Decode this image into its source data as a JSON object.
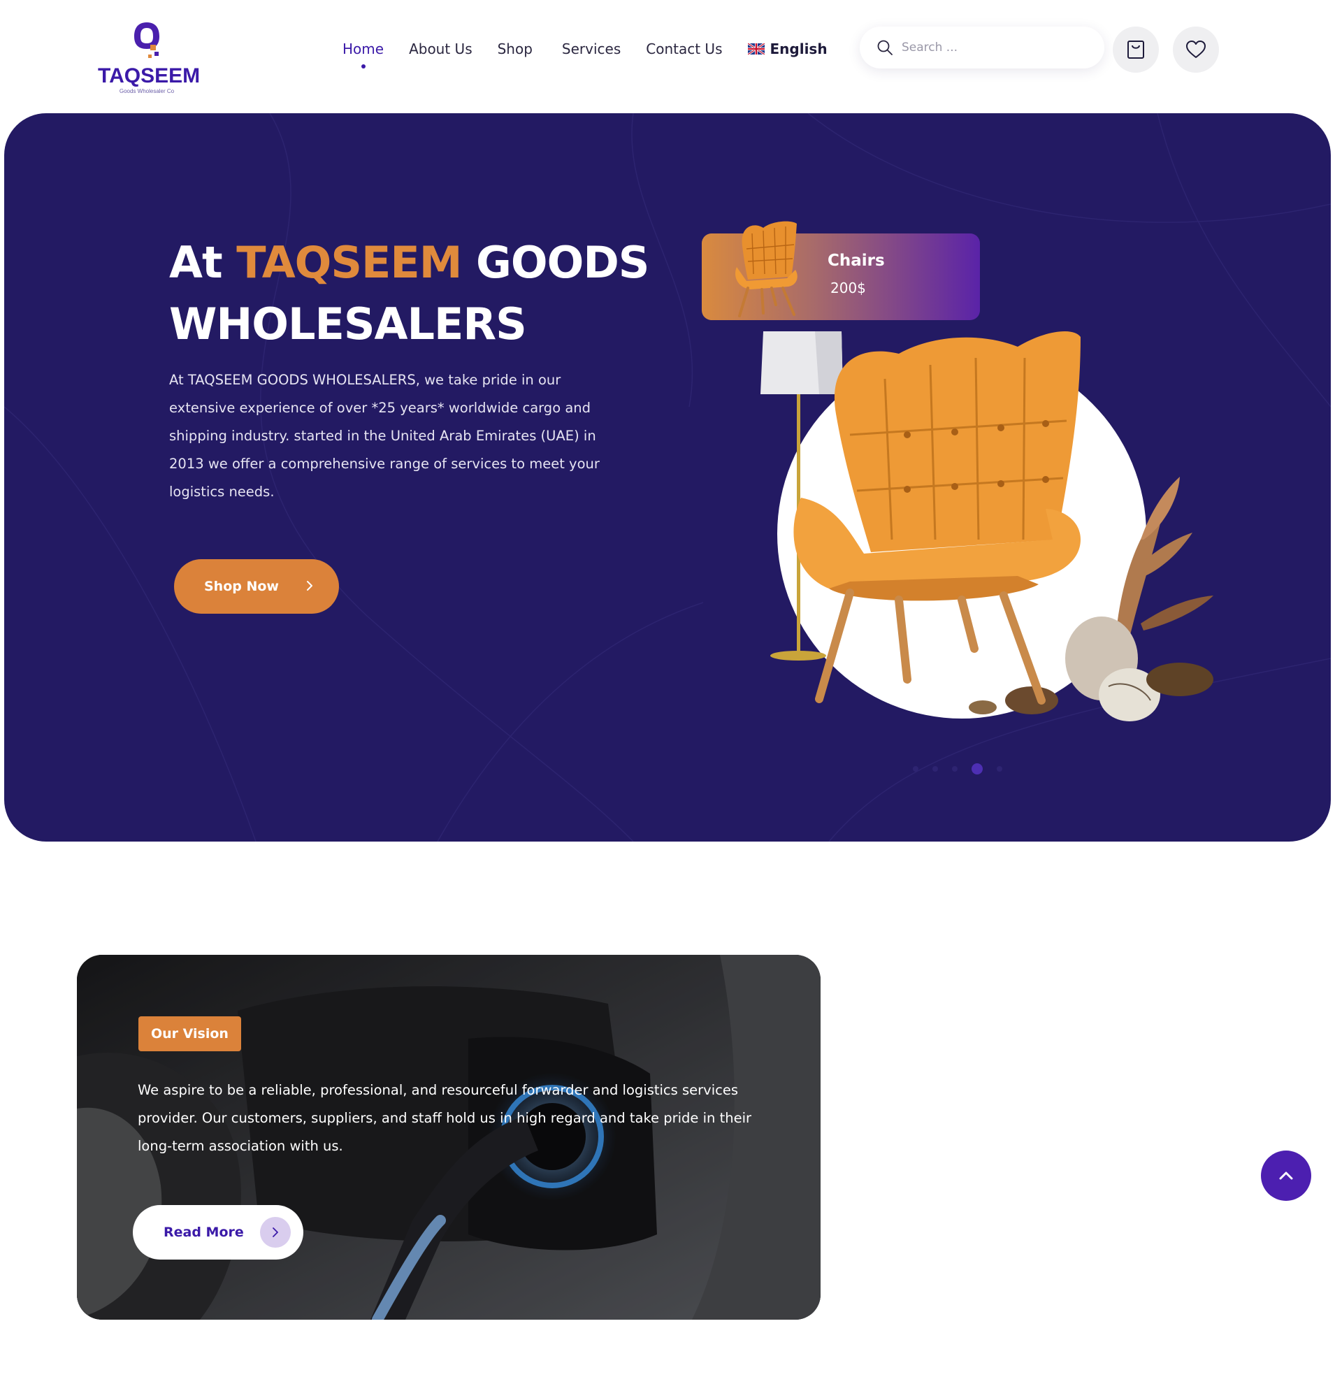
{
  "brand": {
    "name": "TAQSEEM",
    "tagline": "Goods Wholesaler Co",
    "colors": {
      "primary": "#3b1aa8",
      "accent": "#db823a",
      "hero_bg": "#231a63"
    }
  },
  "nav": {
    "items": [
      {
        "label": "Home",
        "active": true
      },
      {
        "label": "About Us"
      },
      {
        "label": "Shop"
      },
      {
        "label": "Services"
      },
      {
        "label": "Contact Us"
      }
    ],
    "language": {
      "label": "English",
      "icon": "uk-flag-icon"
    }
  },
  "search": {
    "placeholder": "Search ..."
  },
  "header_icons": [
    "shopping-bag-icon",
    "heart-icon"
  ],
  "hero": {
    "title_prefix": "At ",
    "title_accent": "TAQSEEM",
    "title_suffix_1": " GOODS",
    "title_line_2": "WHOLESALERS",
    "description": "At TAQSEEM GOODS WHOLESALERS, we take pride in our extensive experience of over *25 years* worldwide cargo and shipping industry. started in the United Arab Emirates (UAE) in 2013 we offer a comprehensive range of services to meet your logistics needs.",
    "cta_label": "Shop Now",
    "product_card": {
      "name": "Chairs",
      "price": "200$"
    },
    "slider": {
      "count": 5,
      "active_index": 3
    }
  },
  "vision": {
    "tag": "Our Vision",
    "text": "We aspire to be a reliable, professional, and resourceful forwarder and logistics services provider. Our customers, suppliers, and staff hold us in high regard and take pride in their long-term association with us.",
    "cta_label": "Read More"
  },
  "scroll_top_icon": "chevron-up-icon"
}
